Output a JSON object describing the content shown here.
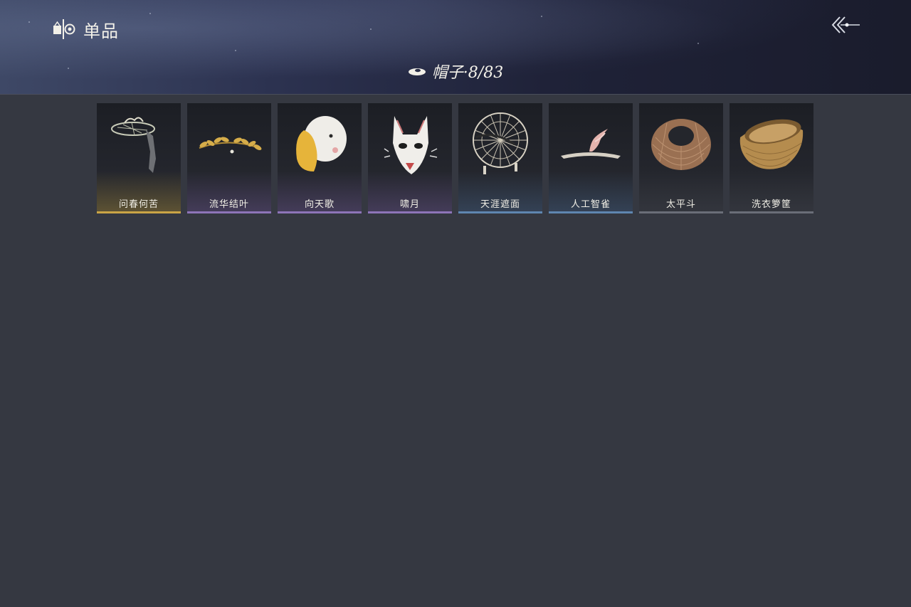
{
  "header": {
    "title": "单品",
    "title_icon": "wardrobe-tab-icon",
    "back_icon": "back-arrow-icon"
  },
  "category": {
    "icon": "hat-icon",
    "label": "帽子·8/83"
  },
  "items": [
    {
      "name": "问春何苦",
      "icon": "veiled-hat-icon",
      "rarity_color": "#c9a446"
    },
    {
      "name": "流华结叶",
      "icon": "golden-leaf-circlet-icon",
      "rarity_color": "#8d74b8"
    },
    {
      "name": "向天歌",
      "icon": "duck-hood-icon",
      "rarity_color": "#8d74b8"
    },
    {
      "name": "啸月",
      "icon": "fox-mask-icon",
      "rarity_color": "#8d74b8"
    },
    {
      "name": "天涯遮面",
      "icon": "wide-bamboo-hat-icon",
      "rarity_color": "#5f86b0"
    },
    {
      "name": "人工智雀",
      "icon": "bird-hairpin-icon",
      "rarity_color": "#5f86b0"
    },
    {
      "name": "太平斗",
      "icon": "woven-bamboo-hat-icon",
      "rarity_color": "#6a6e78"
    },
    {
      "name": "洗衣箩筐",
      "icon": "laundry-basket-icon",
      "rarity_color": "#6a6e78"
    }
  ]
}
